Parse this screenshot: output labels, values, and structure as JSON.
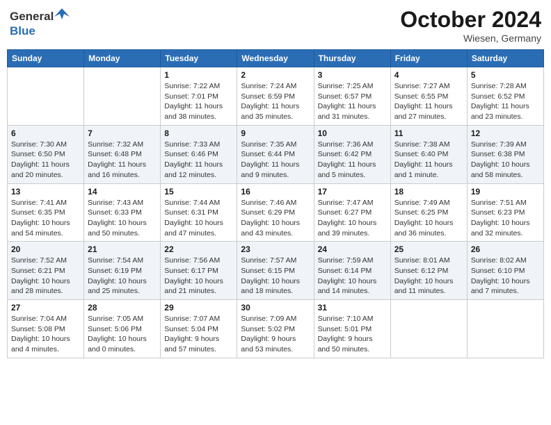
{
  "header": {
    "month_title": "October 2024",
    "location": "Wiesen, Germany",
    "logo_general": "General",
    "logo_blue": "Blue"
  },
  "days_of_week": [
    "Sunday",
    "Monday",
    "Tuesday",
    "Wednesday",
    "Thursday",
    "Friday",
    "Saturday"
  ],
  "weeks": [
    [
      {
        "day": "",
        "info": ""
      },
      {
        "day": "",
        "info": ""
      },
      {
        "day": "1",
        "info": "Sunrise: 7:22 AM\nSunset: 7:01 PM\nDaylight: 11 hours and 38 minutes."
      },
      {
        "day": "2",
        "info": "Sunrise: 7:24 AM\nSunset: 6:59 PM\nDaylight: 11 hours and 35 minutes."
      },
      {
        "day": "3",
        "info": "Sunrise: 7:25 AM\nSunset: 6:57 PM\nDaylight: 11 hours and 31 minutes."
      },
      {
        "day": "4",
        "info": "Sunrise: 7:27 AM\nSunset: 6:55 PM\nDaylight: 11 hours and 27 minutes."
      },
      {
        "day": "5",
        "info": "Sunrise: 7:28 AM\nSunset: 6:52 PM\nDaylight: 11 hours and 23 minutes."
      }
    ],
    [
      {
        "day": "6",
        "info": "Sunrise: 7:30 AM\nSunset: 6:50 PM\nDaylight: 11 hours and 20 minutes."
      },
      {
        "day": "7",
        "info": "Sunrise: 7:32 AM\nSunset: 6:48 PM\nDaylight: 11 hours and 16 minutes."
      },
      {
        "day": "8",
        "info": "Sunrise: 7:33 AM\nSunset: 6:46 PM\nDaylight: 11 hours and 12 minutes."
      },
      {
        "day": "9",
        "info": "Sunrise: 7:35 AM\nSunset: 6:44 PM\nDaylight: 11 hours and 9 minutes."
      },
      {
        "day": "10",
        "info": "Sunrise: 7:36 AM\nSunset: 6:42 PM\nDaylight: 11 hours and 5 minutes."
      },
      {
        "day": "11",
        "info": "Sunrise: 7:38 AM\nSunset: 6:40 PM\nDaylight: 11 hours and 1 minute."
      },
      {
        "day": "12",
        "info": "Sunrise: 7:39 AM\nSunset: 6:38 PM\nDaylight: 10 hours and 58 minutes."
      }
    ],
    [
      {
        "day": "13",
        "info": "Sunrise: 7:41 AM\nSunset: 6:35 PM\nDaylight: 10 hours and 54 minutes."
      },
      {
        "day": "14",
        "info": "Sunrise: 7:43 AM\nSunset: 6:33 PM\nDaylight: 10 hours and 50 minutes."
      },
      {
        "day": "15",
        "info": "Sunrise: 7:44 AM\nSunset: 6:31 PM\nDaylight: 10 hours and 47 minutes."
      },
      {
        "day": "16",
        "info": "Sunrise: 7:46 AM\nSunset: 6:29 PM\nDaylight: 10 hours and 43 minutes."
      },
      {
        "day": "17",
        "info": "Sunrise: 7:47 AM\nSunset: 6:27 PM\nDaylight: 10 hours and 39 minutes."
      },
      {
        "day": "18",
        "info": "Sunrise: 7:49 AM\nSunset: 6:25 PM\nDaylight: 10 hours and 36 minutes."
      },
      {
        "day": "19",
        "info": "Sunrise: 7:51 AM\nSunset: 6:23 PM\nDaylight: 10 hours and 32 minutes."
      }
    ],
    [
      {
        "day": "20",
        "info": "Sunrise: 7:52 AM\nSunset: 6:21 PM\nDaylight: 10 hours and 28 minutes."
      },
      {
        "day": "21",
        "info": "Sunrise: 7:54 AM\nSunset: 6:19 PM\nDaylight: 10 hours and 25 minutes."
      },
      {
        "day": "22",
        "info": "Sunrise: 7:56 AM\nSunset: 6:17 PM\nDaylight: 10 hours and 21 minutes."
      },
      {
        "day": "23",
        "info": "Sunrise: 7:57 AM\nSunset: 6:15 PM\nDaylight: 10 hours and 18 minutes."
      },
      {
        "day": "24",
        "info": "Sunrise: 7:59 AM\nSunset: 6:14 PM\nDaylight: 10 hours and 14 minutes."
      },
      {
        "day": "25",
        "info": "Sunrise: 8:01 AM\nSunset: 6:12 PM\nDaylight: 10 hours and 11 minutes."
      },
      {
        "day": "26",
        "info": "Sunrise: 8:02 AM\nSunset: 6:10 PM\nDaylight: 10 hours and 7 minutes."
      }
    ],
    [
      {
        "day": "27",
        "info": "Sunrise: 7:04 AM\nSunset: 5:08 PM\nDaylight: 10 hours and 4 minutes."
      },
      {
        "day": "28",
        "info": "Sunrise: 7:05 AM\nSunset: 5:06 PM\nDaylight: 10 hours and 0 minutes."
      },
      {
        "day": "29",
        "info": "Sunrise: 7:07 AM\nSunset: 5:04 PM\nDaylight: 9 hours and 57 minutes."
      },
      {
        "day": "30",
        "info": "Sunrise: 7:09 AM\nSunset: 5:02 PM\nDaylight: 9 hours and 53 minutes."
      },
      {
        "day": "31",
        "info": "Sunrise: 7:10 AM\nSunset: 5:01 PM\nDaylight: 9 hours and 50 minutes."
      },
      {
        "day": "",
        "info": ""
      },
      {
        "day": "",
        "info": ""
      }
    ]
  ]
}
